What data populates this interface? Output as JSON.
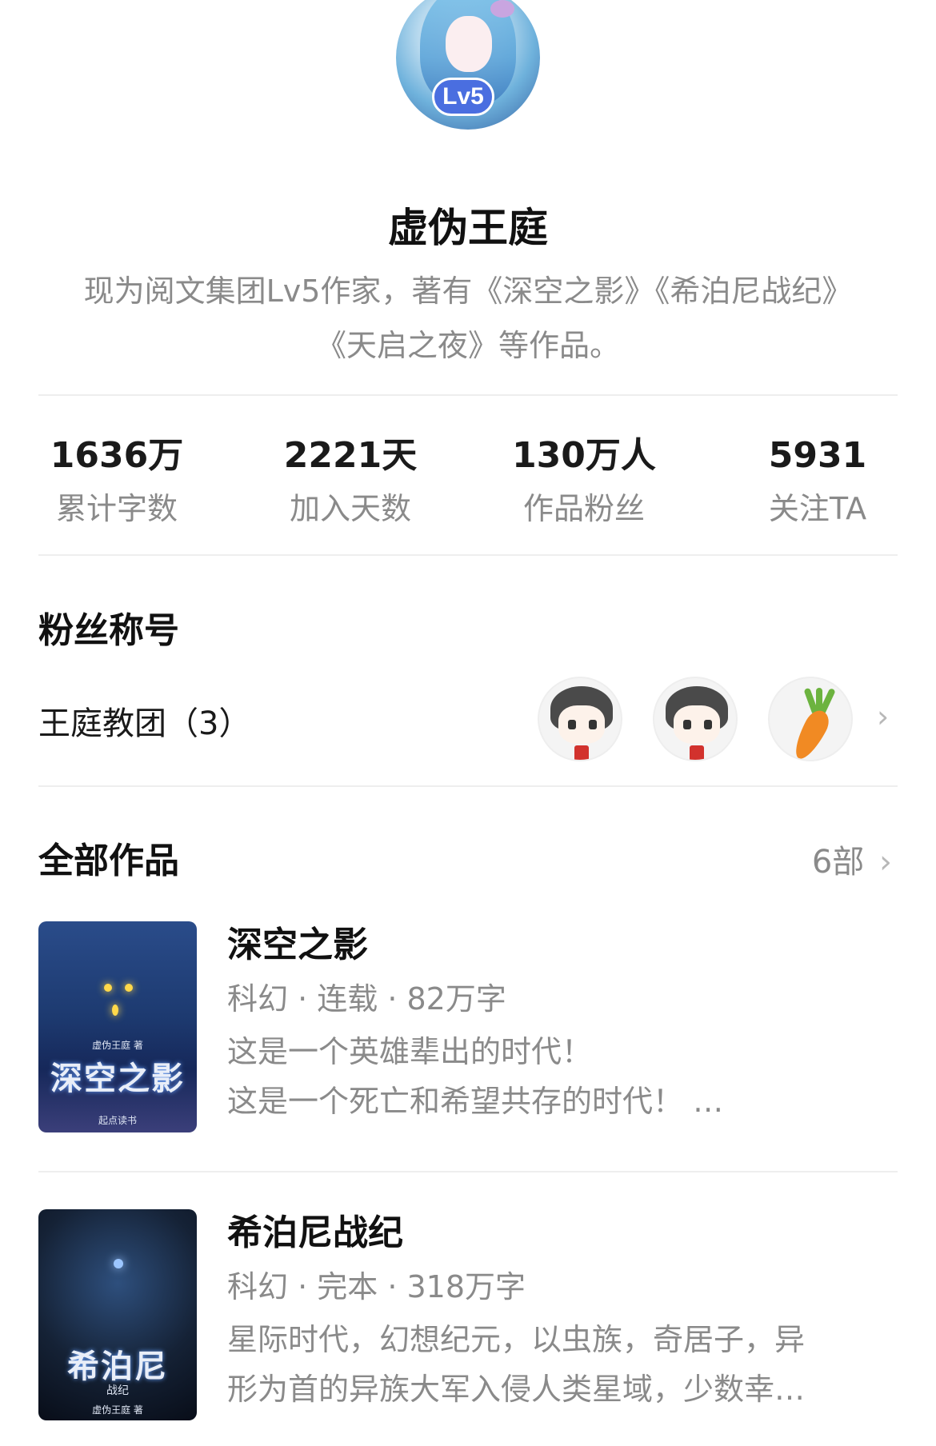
{
  "profile": {
    "level_badge": "Lv5",
    "name": "虚伪王庭",
    "bio_line1": "现为阅文集团Lv5作家，著有《深空之影》《希泊尼战纪》",
    "bio_line2": "《天启之夜》等作品。"
  },
  "stats": [
    {
      "value": "1636万",
      "label": "累计字数"
    },
    {
      "value": "2221天",
      "label": "加入天数"
    },
    {
      "value": "130万人",
      "label": "作品粉丝"
    },
    {
      "value": "5931",
      "label": "关注TA"
    }
  ],
  "fan_title": {
    "section_title": "粉丝称号",
    "group_label": "王庭教团（3）",
    "avatars": [
      "boy-avatar",
      "boy-avatar",
      "carrot-avatar"
    ]
  },
  "works": {
    "section_title": "全部作品",
    "count": "6部",
    "books": [
      {
        "title": "深空之影",
        "meta": "科幻 · 连载 · 82万字",
        "desc_line1": "这是一个英雄辈出的时代！",
        "desc_line2": "这是一个死亡和希望共存的时代！ …",
        "cover_title": "深空之影",
        "cover_author": "虚伪王庭 著",
        "cover_brand": "起点读书"
      },
      {
        "title": "希泊尼战纪",
        "meta": "科幻 · 完本 · 318万字",
        "desc_line1": "星际时代，幻想纪元，以虫族，奇居子，异",
        "desc_line2": "形为首的异族大军入侵人类星域，少数幸…",
        "cover_title": "希泊尼",
        "cover_subtitle": "战纪",
        "cover_author": "虚伪王庭 著"
      }
    ]
  },
  "colors": {
    "badge": "#4a6ee0",
    "text_primary": "#111111",
    "text_secondary": "#8a8a8a",
    "divider": "#eeeeee"
  }
}
